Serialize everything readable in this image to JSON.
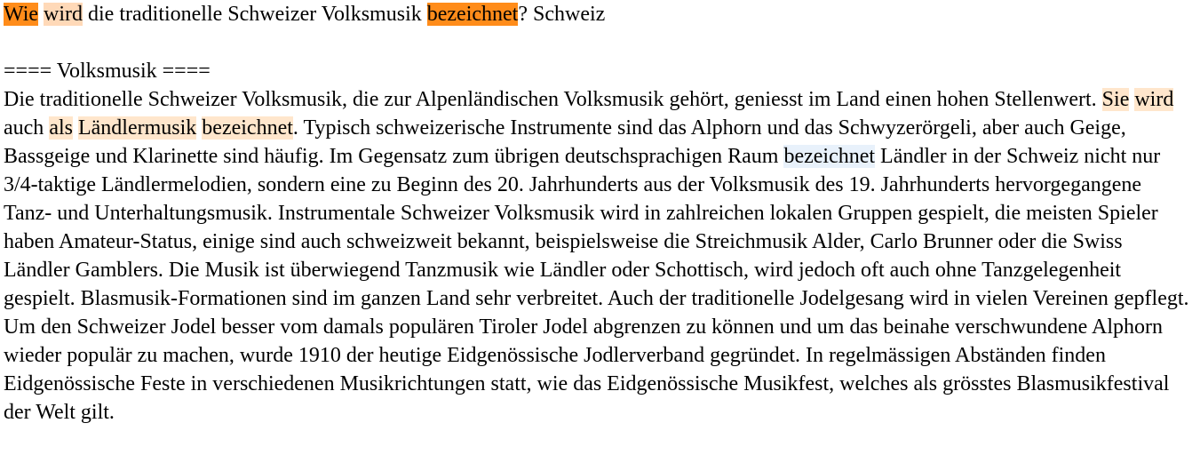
{
  "question": {
    "tokens": [
      {
        "text": "Wie",
        "hl": "strong"
      },
      {
        "text": " ",
        "hl": ""
      },
      {
        "text": "wird",
        "hl": "medium"
      },
      {
        "text": " die traditionelle Schweizer Volksmusik ",
        "hl": ""
      },
      {
        "text": "bezeichnet",
        "hl": "strong"
      },
      {
        "text": "? Schweiz",
        "hl": ""
      }
    ]
  },
  "heading": "==== Volksmusik ====",
  "paragraph": {
    "tokens": [
      {
        "text": "Die traditionelle Schweizer Volksmusik, die zur Alpenländischen Volksmusik gehört, geniesst im Land einen hohen Stellenwert. ",
        "hl": ""
      },
      {
        "text": "Sie",
        "hl": "light"
      },
      {
        "text": " ",
        "hl": ""
      },
      {
        "text": "wird",
        "hl": "light"
      },
      {
        "text": " auch ",
        "hl": ""
      },
      {
        "text": "als",
        "hl": "light"
      },
      {
        "text": " ",
        "hl": ""
      },
      {
        "text": "Ländlermusik",
        "hl": "light"
      },
      {
        "text": " ",
        "hl": ""
      },
      {
        "text": "bezeichnet",
        "hl": "light"
      },
      {
        "text": ". Typisch schweizerische Instrumente sind das Alphorn und das Schwyzerörgeli, aber auch Geige, Bassgeige und Klarinette sind häufig. Im Gegensatz zum übrigen deutschsprachigen Raum ",
        "hl": ""
      },
      {
        "text": "bezeichnet",
        "hl": "blue"
      },
      {
        "text": " Ländler in der Schweiz nicht nur 3/4-taktige Ländlermelodien, sondern eine zu Beginn des 20. Jahrhunderts aus der Volksmusik des 19. Jahrhunderts hervorgegangene Tanz- und Unterhaltungsmusik. Instrumentale Schweizer Volksmusik wird in zahlreichen lokalen Gruppen gespielt, die meisten Spieler haben Amateur-Status, einige sind auch schweizweit bekannt, beispielsweise die Streichmusik Alder, Carlo Brunner oder die Swiss Ländler Gamblers. Die Musik ist überwiegend Tanzmusik wie Ländler oder Schottisch, wird jedoch oft auch ohne Tanzgelegenheit gespielt. Blasmusik-Formationen sind im ganzen Land sehr verbreitet. Auch der traditionelle Jodelgesang wird in vielen Vereinen gepflegt. Um den Schweizer Jodel besser vom damals populären Tiroler Jodel abgrenzen zu können und um das beinahe verschwundene Alphorn wieder populär zu machen, wurde 1910 der heutige Eidgenössische Jodlerverband gegründet. In regelmässigen Abständen finden Eidgenössische Feste in verschiedenen Musikrichtungen statt, wie das Eidgenössische Musikfest, welches als grösstes Blasmusikfestival der Welt gilt.",
        "hl": ""
      }
    ]
  },
  "colors": {
    "strong": "#ff8c1a",
    "medium": "#ffd9b8",
    "light": "#ffe6cc",
    "blue": "#e8f1fb"
  }
}
